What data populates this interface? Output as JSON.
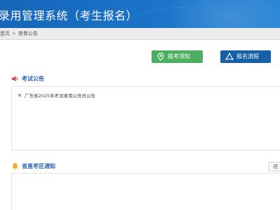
{
  "header": {
    "title": "录用管理系统（考生报名）"
  },
  "breadcrumb": {
    "home": "首页",
    "separator": ">",
    "current": "查看公告"
  },
  "actions": {
    "guide_label": "报考须知",
    "flow_label": "报名流程"
  },
  "exam_notice": {
    "title": "考试公告",
    "items": [
      {
        "text": "广东省2025年考试录用公务员公告"
      }
    ]
  },
  "region_notice": {
    "title": "省直考区通知",
    "more_label": "进"
  },
  "colors": {
    "header_blue": "#1b74c9",
    "guide_green": "#4cae5f",
    "flow_blue": "#175fa6",
    "section_title": "#2a63b0",
    "speaker_red": "#e03a3a",
    "bell_orange": "#f5a623"
  },
  "icons": {
    "guide": "location-pin-icon",
    "flow": "flow-icon",
    "exam_notice": "speaker-icon",
    "region_notice": "bell-icon"
  }
}
